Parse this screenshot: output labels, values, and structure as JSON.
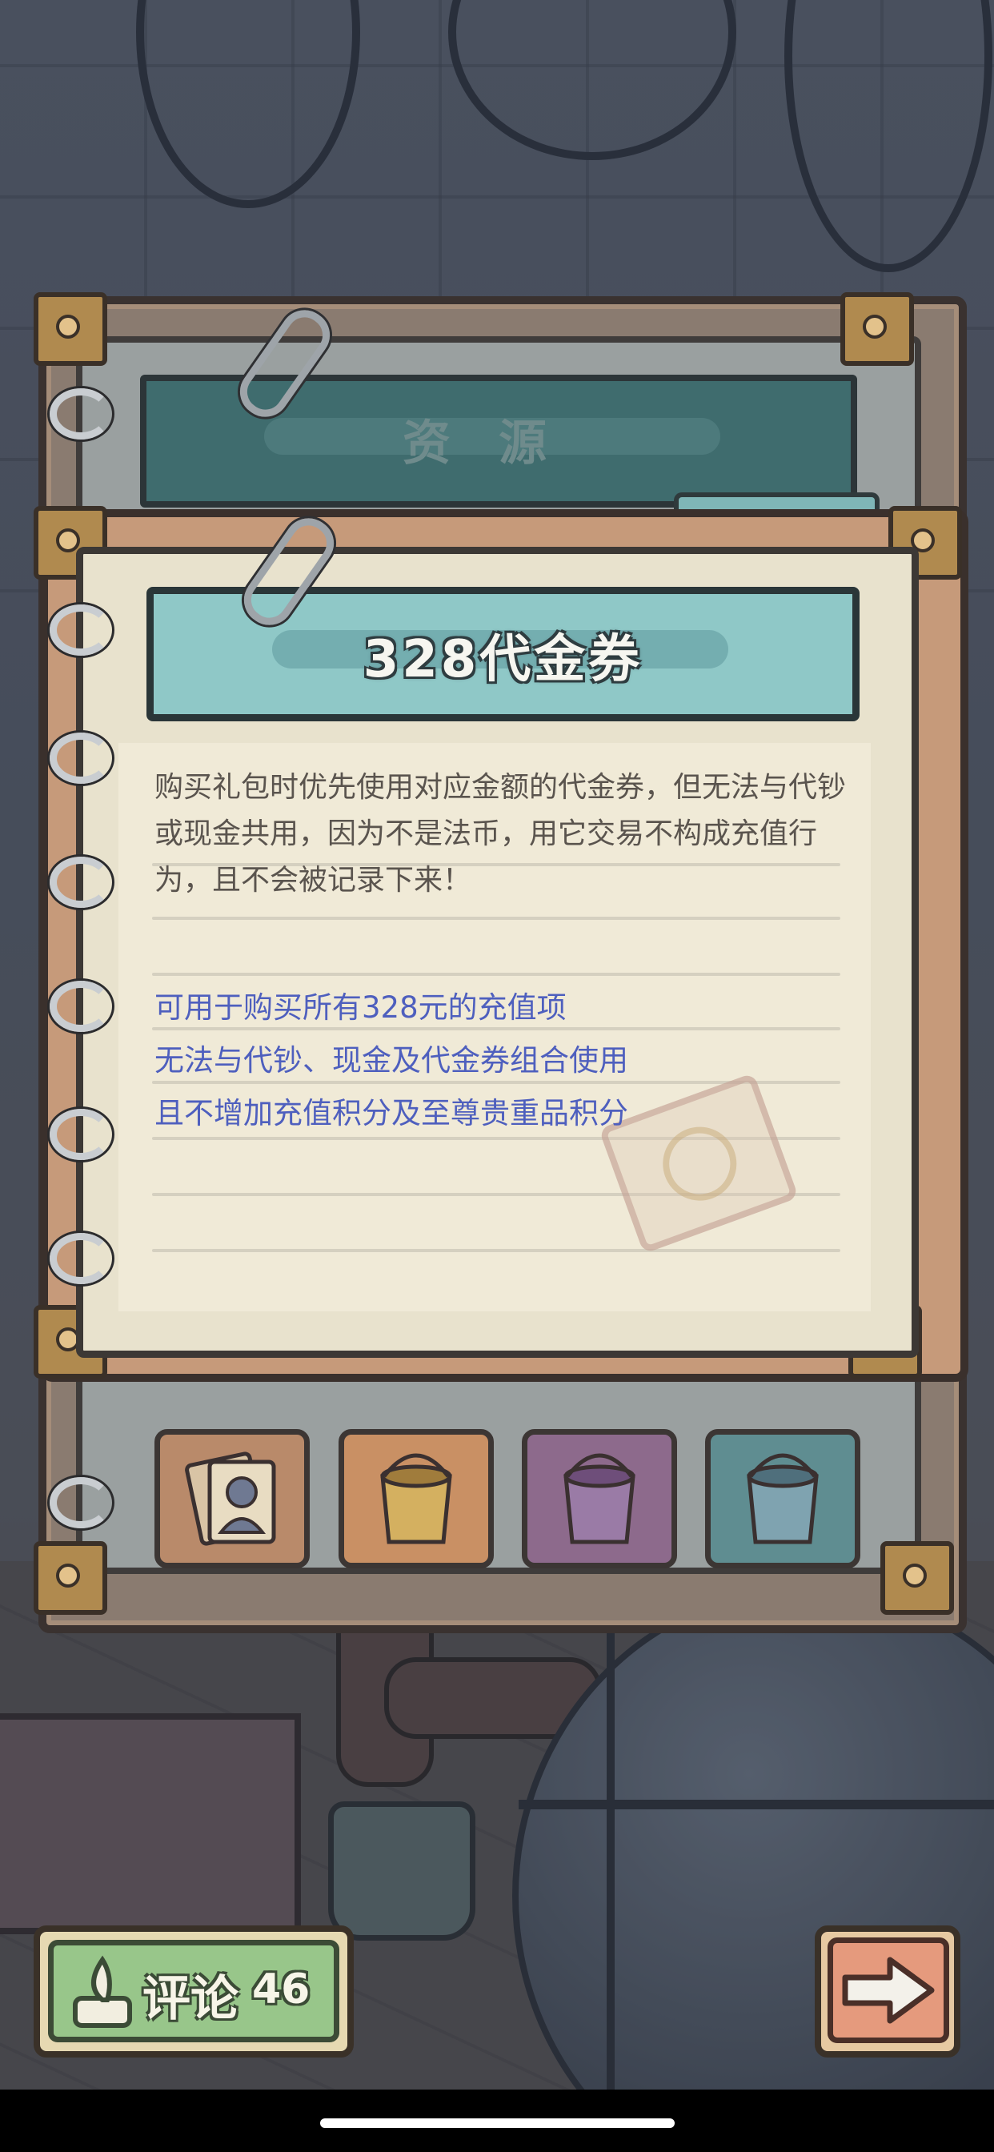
{
  "back_panel": {
    "title": "资源",
    "tab_label": "资源"
  },
  "dialog": {
    "title": "328代金券",
    "description": "购买礼包时优先使用对应金额的代金券，但无法与代钞或现金共用，因为不是法币，用它交易不构成充值行为，且不会被记录下来！",
    "features": [
      "可用于购买所有328元的充值项",
      "无法与代钞、现金及代金券组合使用",
      "且不增加充值积分及至尊贵重品积分"
    ]
  },
  "items": [
    {
      "icon": "portrait-card-icon",
      "color": "#c98a5e"
    },
    {
      "icon": "paint-bucket-icon",
      "color": "#c98a5e"
    },
    {
      "icon": "paint-bucket-icon",
      "color": "#8d6a8c"
    },
    {
      "icon": "paint-bucket-icon",
      "color": "#5f8d91"
    }
  ],
  "footer": {
    "comment_label": "评论",
    "comment_count": "46",
    "next_icon": "arrow-right-icon",
    "comment_icon": "quill-icon"
  },
  "colors": {
    "header": "#8fc8c7",
    "page": "#e8e2cd",
    "feature_text": "#4e5fbe",
    "comment_button": "#98c68a",
    "next_button": "#e59a7d"
  }
}
